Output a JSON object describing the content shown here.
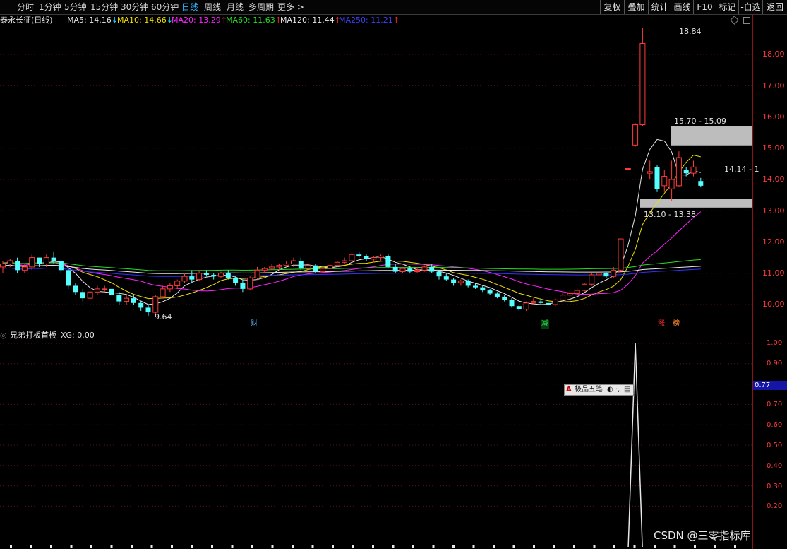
{
  "toolbar": {
    "periods": [
      "分时",
      "1分钟",
      "5分钟",
      "15分钟",
      "30分钟",
      "60分钟",
      "日线",
      "周线",
      "月线",
      "多周期",
      "更多 >"
    ],
    "active_period": "日线",
    "tools": [
      "复权",
      "叠加",
      "统计",
      "画线",
      "F10",
      "标记",
      "-自选",
      "返回"
    ]
  },
  "main_chart": {
    "stock_name": "泰永长征(日线)",
    "ma": [
      {
        "label": "MA5: 14.16",
        "dir": "down",
        "color": "#e8e8e8"
      },
      {
        "label": "MA10: 14.66",
        "dir": "down",
        "color": "#f0e000"
      },
      {
        "label": "MA20: 13.29",
        "dir": "up",
        "color": "#ff22ff"
      },
      {
        "label": "MA60: 11.63",
        "dir": "up",
        "color": "#22e022"
      },
      {
        "label": "MA120: 11.44",
        "dir": "up",
        "color": "#e8e8e8"
      },
      {
        "label": "MA250: 11.21",
        "dir": "up",
        "color": "#2d2dff"
      }
    ],
    "y_ticks": [
      "18.00",
      "17.00",
      "16.00",
      "15.00",
      "14.00",
      "13.00",
      "12.00",
      "11.00",
      "10.00"
    ],
    "annotations": {
      "high": "18.84",
      "low": "9.64",
      "zone_upper": "15.70 - 15.09",
      "zone_lower": "13.10 - 13.38",
      "last": "14.14 - 1"
    },
    "event_tags": [
      {
        "text": "财",
        "type": "blue"
      },
      {
        "text": "减",
        "type": "green"
      },
      {
        "text": "涨",
        "type": "red"
      },
      {
        "text": "榜",
        "type": "orange"
      }
    ],
    "colors": {
      "up": "#ff3b3b",
      "down": "#54ffff",
      "axis": "#ff3b3b",
      "grid": "#5a1010"
    }
  },
  "sub_chart": {
    "title": "兄弟打板首板",
    "xg": "XG: 0.00",
    "y_ticks": [
      "1.00",
      "0.90",
      "0.80",
      "0.70",
      "0.60",
      "0.50",
      "0.40",
      "0.30",
      "0.20"
    ],
    "current_value": "0.77"
  },
  "ime_bar": {
    "label": "极品五笔"
  },
  "watermark": "CSDN @三零指标库",
  "chart_data": {
    "type": "candlestick",
    "ylim": [
      9.5,
      19.0
    ],
    "candles": [
      [
        11.2,
        11.4,
        11.0,
        11.3
      ],
      [
        11.3,
        11.45,
        11.2,
        11.4
      ],
      [
        11.4,
        11.5,
        11.0,
        11.1
      ],
      [
        11.1,
        11.3,
        11.0,
        11.2
      ],
      [
        11.2,
        11.6,
        11.1,
        11.5
      ],
      [
        11.5,
        11.5,
        11.2,
        11.3
      ],
      [
        11.3,
        11.6,
        11.2,
        11.5
      ],
      [
        11.5,
        11.7,
        11.3,
        11.4
      ],
      [
        11.4,
        11.4,
        11.0,
        11.1
      ],
      [
        11.1,
        11.2,
        10.5,
        10.6
      ],
      [
        10.6,
        10.7,
        10.3,
        10.4
      ],
      [
        10.4,
        10.5,
        10.1,
        10.2
      ],
      [
        10.2,
        10.5,
        10.15,
        10.4
      ],
      [
        10.4,
        10.6,
        10.3,
        10.5
      ],
      [
        10.5,
        10.6,
        10.4,
        10.5
      ],
      [
        10.5,
        10.6,
        10.2,
        10.3
      ],
      [
        10.3,
        10.4,
        10.0,
        10.1
      ],
      [
        10.1,
        10.3,
        10.0,
        10.2
      ],
      [
        10.2,
        10.3,
        10.0,
        10.05
      ],
      [
        10.05,
        10.1,
        9.8,
        9.9
      ],
      [
        9.9,
        10.0,
        9.64,
        9.75
      ],
      [
        9.75,
        10.3,
        9.7,
        10.25
      ],
      [
        10.25,
        10.6,
        10.2,
        10.5
      ],
      [
        10.5,
        10.7,
        10.4,
        10.6
      ],
      [
        10.6,
        10.8,
        10.5,
        10.75
      ],
      [
        10.75,
        11.0,
        10.7,
        10.9
      ],
      [
        10.9,
        11.1,
        10.7,
        10.8
      ],
      [
        10.8,
        11.1,
        10.75,
        11.0
      ],
      [
        11.0,
        11.1,
        10.9,
        10.95
      ],
      [
        10.95,
        11.0,
        10.8,
        10.9
      ],
      [
        10.9,
        11.05,
        10.85,
        11.0
      ],
      [
        11.0,
        11.1,
        10.8,
        10.85
      ],
      [
        10.85,
        10.9,
        10.6,
        10.7
      ],
      [
        10.7,
        10.8,
        10.4,
        10.5
      ],
      [
        10.5,
        10.9,
        10.45,
        10.85
      ],
      [
        10.85,
        11.2,
        10.8,
        11.1
      ],
      [
        11.1,
        11.2,
        11.0,
        11.15
      ],
      [
        11.15,
        11.3,
        11.1,
        11.2
      ],
      [
        11.2,
        11.3,
        11.1,
        11.25
      ],
      [
        11.25,
        11.4,
        11.2,
        11.3
      ],
      [
        11.3,
        11.5,
        11.2,
        11.4
      ],
      [
        11.4,
        11.5,
        11.1,
        11.15
      ],
      [
        11.15,
        11.3,
        11.1,
        11.25
      ],
      [
        11.25,
        11.3,
        11.0,
        11.05
      ],
      [
        11.05,
        11.2,
        11.0,
        11.15
      ],
      [
        11.15,
        11.3,
        11.1,
        11.25
      ],
      [
        11.25,
        11.4,
        11.2,
        11.35
      ],
      [
        11.35,
        11.5,
        11.3,
        11.4
      ],
      [
        11.4,
        11.7,
        11.35,
        11.6
      ],
      [
        11.6,
        11.7,
        11.5,
        11.55
      ],
      [
        11.55,
        11.6,
        11.4,
        11.45
      ],
      [
        11.45,
        11.55,
        11.35,
        11.5
      ],
      [
        11.5,
        11.6,
        11.4,
        11.55
      ],
      [
        11.55,
        11.6,
        11.15,
        11.2
      ],
      [
        11.2,
        11.3,
        11.0,
        11.05
      ],
      [
        11.05,
        11.2,
        11.0,
        11.15
      ],
      [
        11.15,
        11.2,
        11.0,
        11.05
      ],
      [
        11.05,
        11.2,
        11.0,
        11.1
      ],
      [
        11.1,
        11.25,
        11.05,
        11.2
      ],
      [
        11.2,
        11.3,
        11.0,
        11.05
      ],
      [
        11.05,
        11.1,
        10.8,
        10.9
      ],
      [
        10.9,
        11.0,
        10.75,
        10.8
      ],
      [
        10.8,
        10.85,
        10.6,
        10.7
      ],
      [
        10.7,
        10.8,
        10.6,
        10.75
      ],
      [
        10.75,
        10.8,
        10.55,
        10.6
      ],
      [
        10.6,
        10.7,
        10.5,
        10.55
      ],
      [
        10.55,
        10.6,
        10.4,
        10.45
      ],
      [
        10.45,
        10.5,
        10.3,
        10.35
      ],
      [
        10.35,
        10.4,
        10.2,
        10.25
      ],
      [
        10.25,
        10.3,
        10.1,
        10.15
      ],
      [
        10.15,
        10.2,
        9.9,
        9.95
      ],
      [
        9.95,
        10.0,
        9.8,
        9.85
      ],
      [
        9.85,
        10.1,
        9.8,
        10.05
      ],
      [
        10.05,
        10.2,
        10.0,
        10.1
      ],
      [
        10.1,
        10.2,
        10.0,
        10.05
      ],
      [
        10.05,
        10.1,
        9.95,
        10.0
      ],
      [
        10.0,
        10.2,
        9.95,
        10.15
      ],
      [
        10.15,
        10.35,
        10.1,
        10.3
      ],
      [
        10.3,
        10.45,
        10.25,
        10.35
      ],
      [
        10.35,
        10.5,
        10.3,
        10.45
      ],
      [
        10.45,
        10.7,
        10.4,
        10.65
      ],
      [
        10.65,
        11.0,
        10.6,
        10.95
      ],
      [
        10.95,
        11.1,
        10.9,
        11.0
      ],
      [
        11.0,
        11.05,
        10.85,
        10.9
      ],
      [
        10.9,
        11.2,
        10.85,
        11.1
      ],
      [
        11.1,
        12.1,
        11.05,
        12.1
      ],
      [
        14.35,
        14.35,
        14.35,
        14.35
      ],
      [
        15.1,
        15.8,
        15.05,
        15.75
      ],
      [
        15.75,
        18.84,
        15.7,
        18.35
      ],
      [
        14.2,
        14.6,
        14.0,
        14.25
      ],
      [
        14.4,
        14.45,
        13.6,
        13.7
      ],
      [
        13.8,
        14.3,
        13.6,
        14.1
      ],
      [
        13.7,
        14.6,
        13.3,
        14.0
      ],
      [
        13.8,
        14.9,
        13.75,
        14.7
      ],
      [
        14.3,
        14.4,
        14.1,
        14.2
      ],
      [
        14.2,
        14.6,
        14.1,
        14.4
      ],
      [
        13.95,
        14.05,
        13.75,
        13.8
      ]
    ],
    "sub_signal": {
      "ylim": [
        0,
        1.0
      ],
      "peak": 1.0,
      "peak_index": 87
    }
  }
}
